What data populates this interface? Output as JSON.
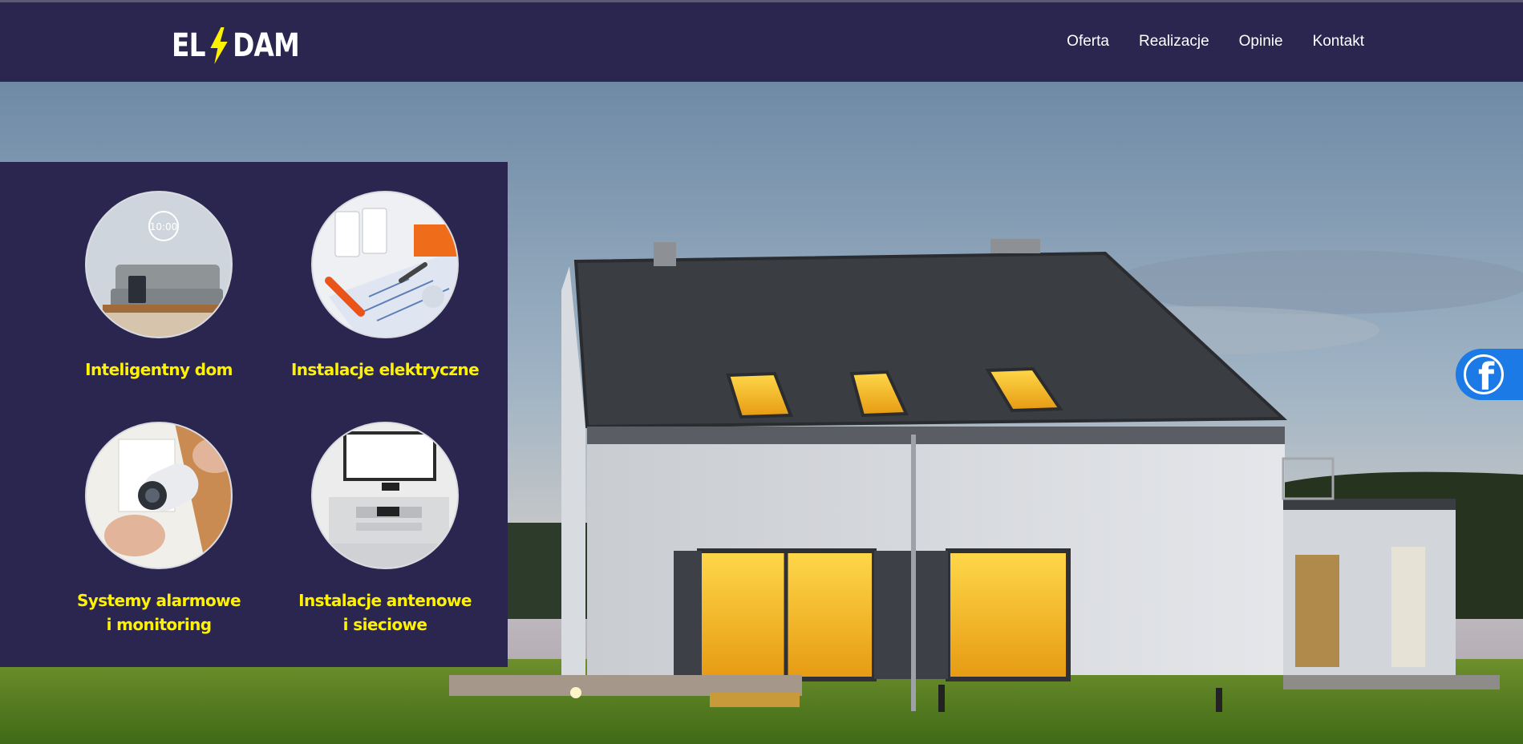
{
  "header": {
    "logo_left": "EL",
    "logo_right": "DAM",
    "logo_bolt_color": "#fff200",
    "background": "#2a2650"
  },
  "nav": {
    "items": [
      "Oferta",
      "Realizacje",
      "Opinie",
      "Kontakt"
    ]
  },
  "services": [
    {
      "lines": [
        "Inteligentny dom"
      ],
      "image": "smart-home-photo"
    },
    {
      "lines": [
        "Instalacje elektryczne"
      ],
      "image": "electrical-installation-photo"
    },
    {
      "lines": [
        "Systemy alarmowe",
        "i monitoring"
      ],
      "image": "cctv-camera-photo"
    },
    {
      "lines": [
        "Instalacje antenowe",
        "i sieciowe"
      ],
      "image": "tv-antenna-network-photo"
    }
  ],
  "hero": {
    "image": "modern-house-at-dusk-photo"
  },
  "social": {
    "icon": "facebook-icon",
    "color": "#1c7ae6",
    "glyph": "f"
  },
  "colors": {
    "accent": "#fff200",
    "panel": "#2a2650"
  }
}
